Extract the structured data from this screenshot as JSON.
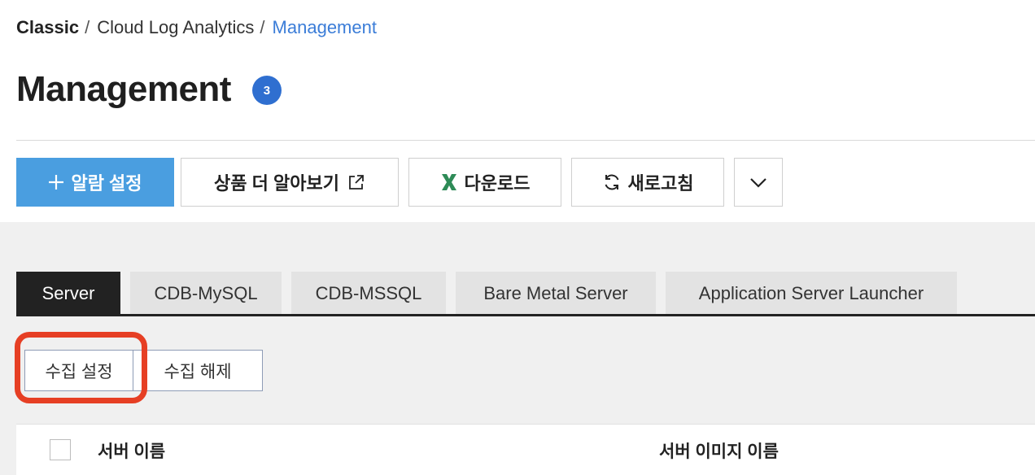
{
  "breadcrumb": {
    "items": [
      "Classic",
      "Cloud Log Analytics",
      "Management"
    ],
    "separator": "/"
  },
  "page": {
    "title": "Management",
    "badge_count": "3"
  },
  "toolbar": {
    "alarm_label": "알람 설정",
    "learn_more_label": "상품 더 알아보기",
    "download_label": "다운로드",
    "refresh_label": "새로고침"
  },
  "tabs": [
    {
      "label": "Server",
      "active": true
    },
    {
      "label": "CDB-MySQL",
      "active": false
    },
    {
      "label": "CDB-MSSQL",
      "active": false
    },
    {
      "label": "Bare Metal Server",
      "active": false
    },
    {
      "label": "Application Server Launcher",
      "active": false
    }
  ],
  "actions": {
    "collect_label": "수집 설정",
    "release_label": "수집 해제"
  },
  "table": {
    "columns": [
      "서버 이름",
      "서버 이미지 이름"
    ]
  },
  "colors": {
    "accent": "#3b7dd8",
    "badge": "#2f6fd0",
    "primary_button": "#4a9ee0",
    "active_tab": "#222222",
    "highlight_ring": "#e63f24",
    "excel_green": "#2e8b57"
  },
  "icons": {
    "add": "plus-icon",
    "external": "external-link-icon",
    "excel": "excel-icon",
    "refresh": "refresh-icon",
    "more": "chevron-down-icon"
  }
}
